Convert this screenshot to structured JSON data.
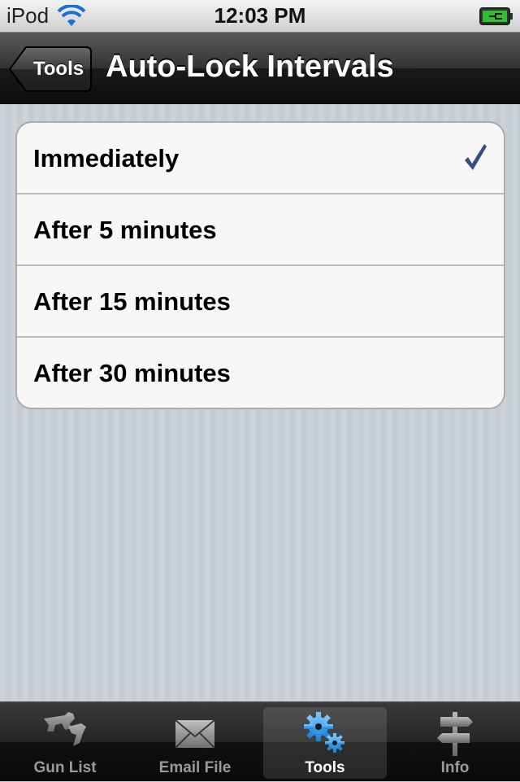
{
  "status_bar": {
    "carrier": "iPod",
    "time": "12:03 PM"
  },
  "nav_bar": {
    "back_label": "Tools",
    "title": "Auto-Lock Intervals"
  },
  "options": [
    {
      "label": "Immediately",
      "selected": true
    },
    {
      "label": "After 5 minutes",
      "selected": false
    },
    {
      "label": "After 15 minutes",
      "selected": false
    },
    {
      "label": "After 30 minutes",
      "selected": false
    }
  ],
  "tab_bar": {
    "tabs": [
      {
        "label": "Gun List",
        "icon": "gun-icon",
        "selected": false
      },
      {
        "label": "Email File",
        "icon": "envelope-icon",
        "selected": false
      },
      {
        "label": "Tools",
        "icon": "gears-icon",
        "selected": true
      },
      {
        "label": "Info",
        "icon": "signpost-icon",
        "selected": false
      }
    ]
  },
  "colors": {
    "checkmark": "#34507f",
    "wifi": "#1a6fd6",
    "battery": "#2fbf2f"
  }
}
